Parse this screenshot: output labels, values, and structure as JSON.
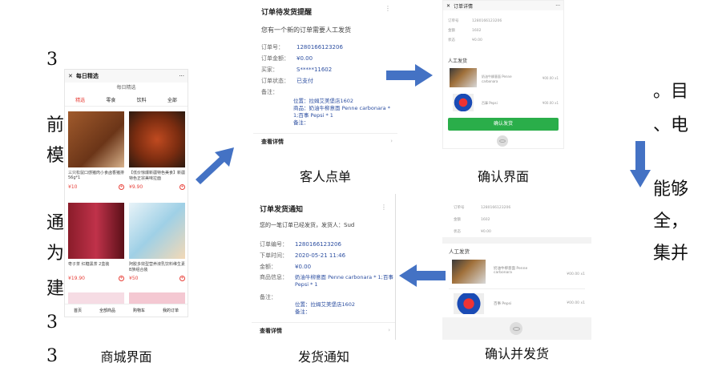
{
  "captions": {
    "mall": "商城界面",
    "order": "客人点单",
    "confirm": "确认界面",
    "notify": "发货通知",
    "confirm_ship": "确认并发货"
  },
  "side_text": {
    "left": [
      "3",
      "前",
      "模",
      "通",
      "为",
      "建",
      "3",
      "3"
    ],
    "right": [
      "。目",
      "、电",
      "能够",
      "全，",
      "集并"
    ]
  },
  "mall": {
    "title": "每日精选",
    "subtitle": "每日精选",
    "tabs": [
      "精选",
      "零食",
      "饮料",
      "全部"
    ],
    "products": [
      {
        "name": "三只松鼠口感猪肉小食卤香猪排56g*1",
        "price": "¥10"
      },
      {
        "name": "【低价惊爆新疆特色美食】新疆特色正宗美味拉面",
        "price": "¥9.90"
      },
      {
        "name": "枣子茶 红糖黑茶 2盒装",
        "price": "¥19.90"
      },
      {
        "name": "阿胶多效型营养液乳饮料维生素B族组合装",
        "price": "¥50"
      }
    ],
    "nav": [
      "首页",
      "全部商品",
      "购物车",
      "我的订单"
    ]
  },
  "order": {
    "title": "订单待发货提醒",
    "intro": "您有一个新的订单需要人工发货",
    "rows": [
      {
        "k": "订单号：",
        "v": "1280166123206"
      },
      {
        "k": "订单金额：",
        "v": "¥0.00"
      },
      {
        "k": "买家：",
        "v": "S*****11602"
      },
      {
        "k": "订单状态：",
        "v": "已支付"
      },
      {
        "k": "备注：",
        "v": ""
      }
    ],
    "address": "位置：拉姆艾美堡店1602",
    "goods": "商品：奶油牛柳意面 Penne carbonara * 1;百事 Pepsi * 1",
    "remark": "备注：",
    "more": "查看详情"
  },
  "confirm": {
    "title": "订单详情",
    "fields": [
      {
        "k": "订单号",
        "v": "1280166123206"
      },
      {
        "k": "金额",
        "v": "1602"
      },
      {
        "k": "状态",
        "v": "¥0.00"
      }
    ],
    "section": "人工发货",
    "items": [
      {
        "name": "奶油牛柳意面 Penne carbonara",
        "price": "¥00.00 x1"
      },
      {
        "name": "百事 Pepsi",
        "price": "¥00.00 x1"
      }
    ],
    "button": "确认发货"
  },
  "notify": {
    "title": "订单发货通知",
    "intro": "您的一笔订单已经发货，发货人：Sud",
    "rows": [
      {
        "k": "订单编号：",
        "v": "1280166123206"
      },
      {
        "k": "下单时间：",
        "v": "2020-05-21 11:46"
      },
      {
        "k": "金额：",
        "v": "¥0.00"
      },
      {
        "k": "商品信息：",
        "v": "奶油牛柳意面 Penne carbonara * 1;百事 Pepsi * 1"
      },
      {
        "k": "备注：",
        "v": ""
      }
    ],
    "address": "位置：拉姆艾美堡店1602",
    "remark": "备注：",
    "more": "查看详情"
  },
  "confirm_ship": {
    "fields": [
      {
        "k": "订单号",
        "v": "1280166123206"
      },
      {
        "k": "金额",
        "v": "1602"
      },
      {
        "k": "状态",
        "v": "¥0.00"
      }
    ],
    "section": "人工发货",
    "items": [
      {
        "name": "奶油牛柳意面 Penne carbonara",
        "price": "¥00.00 x1"
      },
      {
        "name": "百事 Pepsi",
        "price": "¥00.00 x1"
      }
    ]
  },
  "colors": {
    "arrow": "#4472c4",
    "button_green": "#2aae4a",
    "price_red": "#e8413a",
    "link_blue": "#2d4fa1"
  }
}
